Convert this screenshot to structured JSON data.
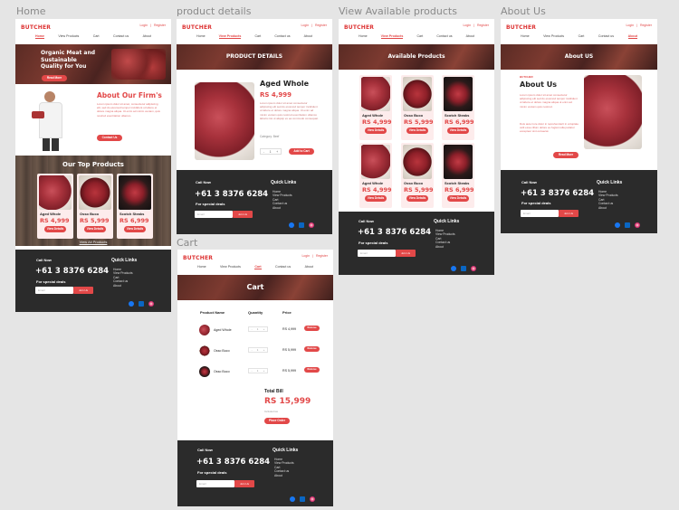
{
  "frame_labels": {
    "home": "Home",
    "product_details": "product details",
    "view_products": "View Available products",
    "about": "About Us",
    "cart": "Cart"
  },
  "brand": {
    "logo": "BUTCHER",
    "tagline": "the finest cuts"
  },
  "auth": {
    "login": "Login",
    "register": "Register"
  },
  "nav": [
    "Home",
    "View Products",
    "Cart",
    "Contact us",
    "About"
  ],
  "home": {
    "hero_title": "Organic Meat and Sustainable Quality for You",
    "hero_button": "Read More",
    "about_title": "About Our Firm's",
    "about_text": "Lorem ipsum dolor sit amet, consectetur adipiscing elit, sed do eiusmod tempor incididunt ut labore et dolore magna aliqua. Ut enim ad minim veniam, quis nostrud exercitation ullamco.",
    "about_button": "Contact Us",
    "top_products_title": "Our Top Products",
    "view_all": "View All Products"
  },
  "products": [
    {
      "name": "Aged Whole",
      "price": "RS 4,999",
      "button": "View Details"
    },
    {
      "name": "Osso Buco",
      "price": "RS 5,999",
      "button": "View Details"
    },
    {
      "name": "Scotch Steaks",
      "price": "RS 6,999",
      "button": "View Details"
    }
  ],
  "details": {
    "banner": "PRODUCT DETAILS",
    "name": "Aged Whole",
    "price": "RS 4,999",
    "description": "Lorem ipsum dolor sit amet consectetur adipiscing elit sed do eiusmod tempor incididunt ut labore et dolore magna aliqua. Ut enim ad minim veniam quis nostrud exercitation ullamco laboris nisi ut aliquip ex ea commodo consequat.",
    "category": "Category: Beef",
    "qty": "1",
    "add_to_cart": "Add to Cart"
  },
  "available": {
    "banner": "Available Products"
  },
  "about_page": {
    "banner": "About US",
    "kicker": "BUTCHER",
    "title": "About Us",
    "text1": "Lorem ipsum dolor sit amet consectetur adipiscing elit sed do eiusmod tempor incididunt ut labore et dolore magna aliqua ut enim ad minim veniam quis nostrud.",
    "text2": "Duis aute irure dolor in reprehenderit in voluptate velit esse cillum dolore eu fugiat nulla pariatur excepteur sint occaecat.",
    "button": "Read More"
  },
  "cart": {
    "banner": "Cart",
    "col_product": "Product Name",
    "col_qty": "Quantity",
    "col_price": "Price",
    "items": [
      {
        "name": "Aged Whole",
        "qty": "1",
        "price": "RS 4,999",
        "remove": "Remove"
      },
      {
        "name": "Osso Buco",
        "qty": "1",
        "price": "RS 5,999",
        "remove": "Remove"
      },
      {
        "name": "Osso Buco",
        "qty": "1",
        "price": "RS 5,999",
        "remove": "Remove"
      }
    ],
    "total_label": "Total Bill",
    "total": "RS 15,999",
    "total_note": "Included tax",
    "place_order": "Place Order"
  },
  "footer": {
    "call_now": "Call Now",
    "phone": "+61 3 8376 6284",
    "special": "For special deals",
    "email_placeholder": "Email",
    "join": "Join Us",
    "quick_links": "Quick Links",
    "links": [
      "Home",
      "View Products",
      "Cart",
      "Contact us",
      "About"
    ],
    "social": [
      "facebook-icon",
      "linkedin-icon",
      "instagram-icon"
    ]
  },
  "colors": {
    "accent": "#e24848",
    "footer": "#2b2b2b",
    "card": "#fdecec"
  }
}
